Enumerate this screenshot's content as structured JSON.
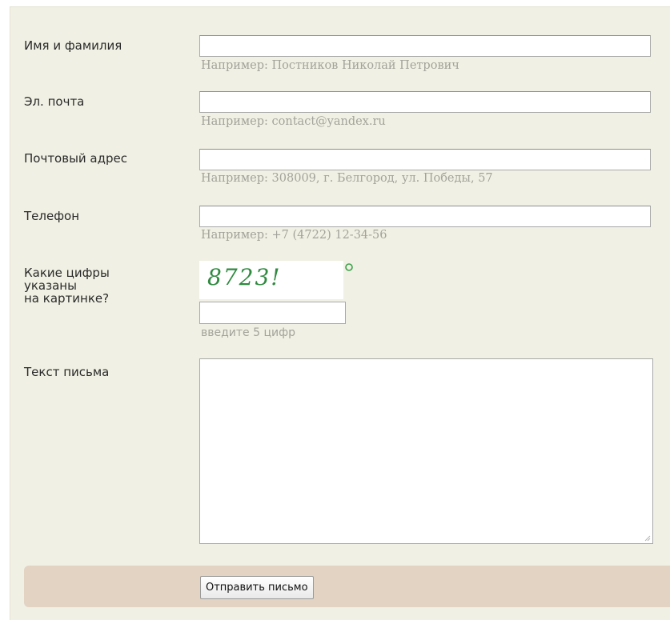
{
  "form": {
    "name": {
      "label": "Имя и фамилия",
      "value": "",
      "hint": "Например: Постников Николай Петрович"
    },
    "email": {
      "label": "Эл. почта",
      "value": "",
      "hint": "Например: contact@yandex.ru"
    },
    "address": {
      "label": "Почтовый адрес",
      "value": "",
      "hint": "Например: 308009, г. Белгород, ул. Победы, 57"
    },
    "phone": {
      "label": "Телефон",
      "value": "",
      "hint": "Например: +7 (4722) 12-34-56"
    },
    "captcha": {
      "label_line1": "Какие цифры",
      "label_line2": "указаны",
      "label_line3": "на картинке?",
      "image_text": "8723!",
      "value": "",
      "hint": "введите 5 цифр"
    },
    "message": {
      "label": "Текст письма",
      "value": ""
    },
    "submit_label": "Отправить письмо"
  },
  "colors": {
    "panel_background": "#f1f0e4",
    "footer_background": "#e2d3c3",
    "hint_text": "#a3a39b",
    "captcha_digits": "#2f8a3f"
  },
  "icons": {
    "refresh": "refresh-icon",
    "resize": "resize-grip-icon"
  }
}
